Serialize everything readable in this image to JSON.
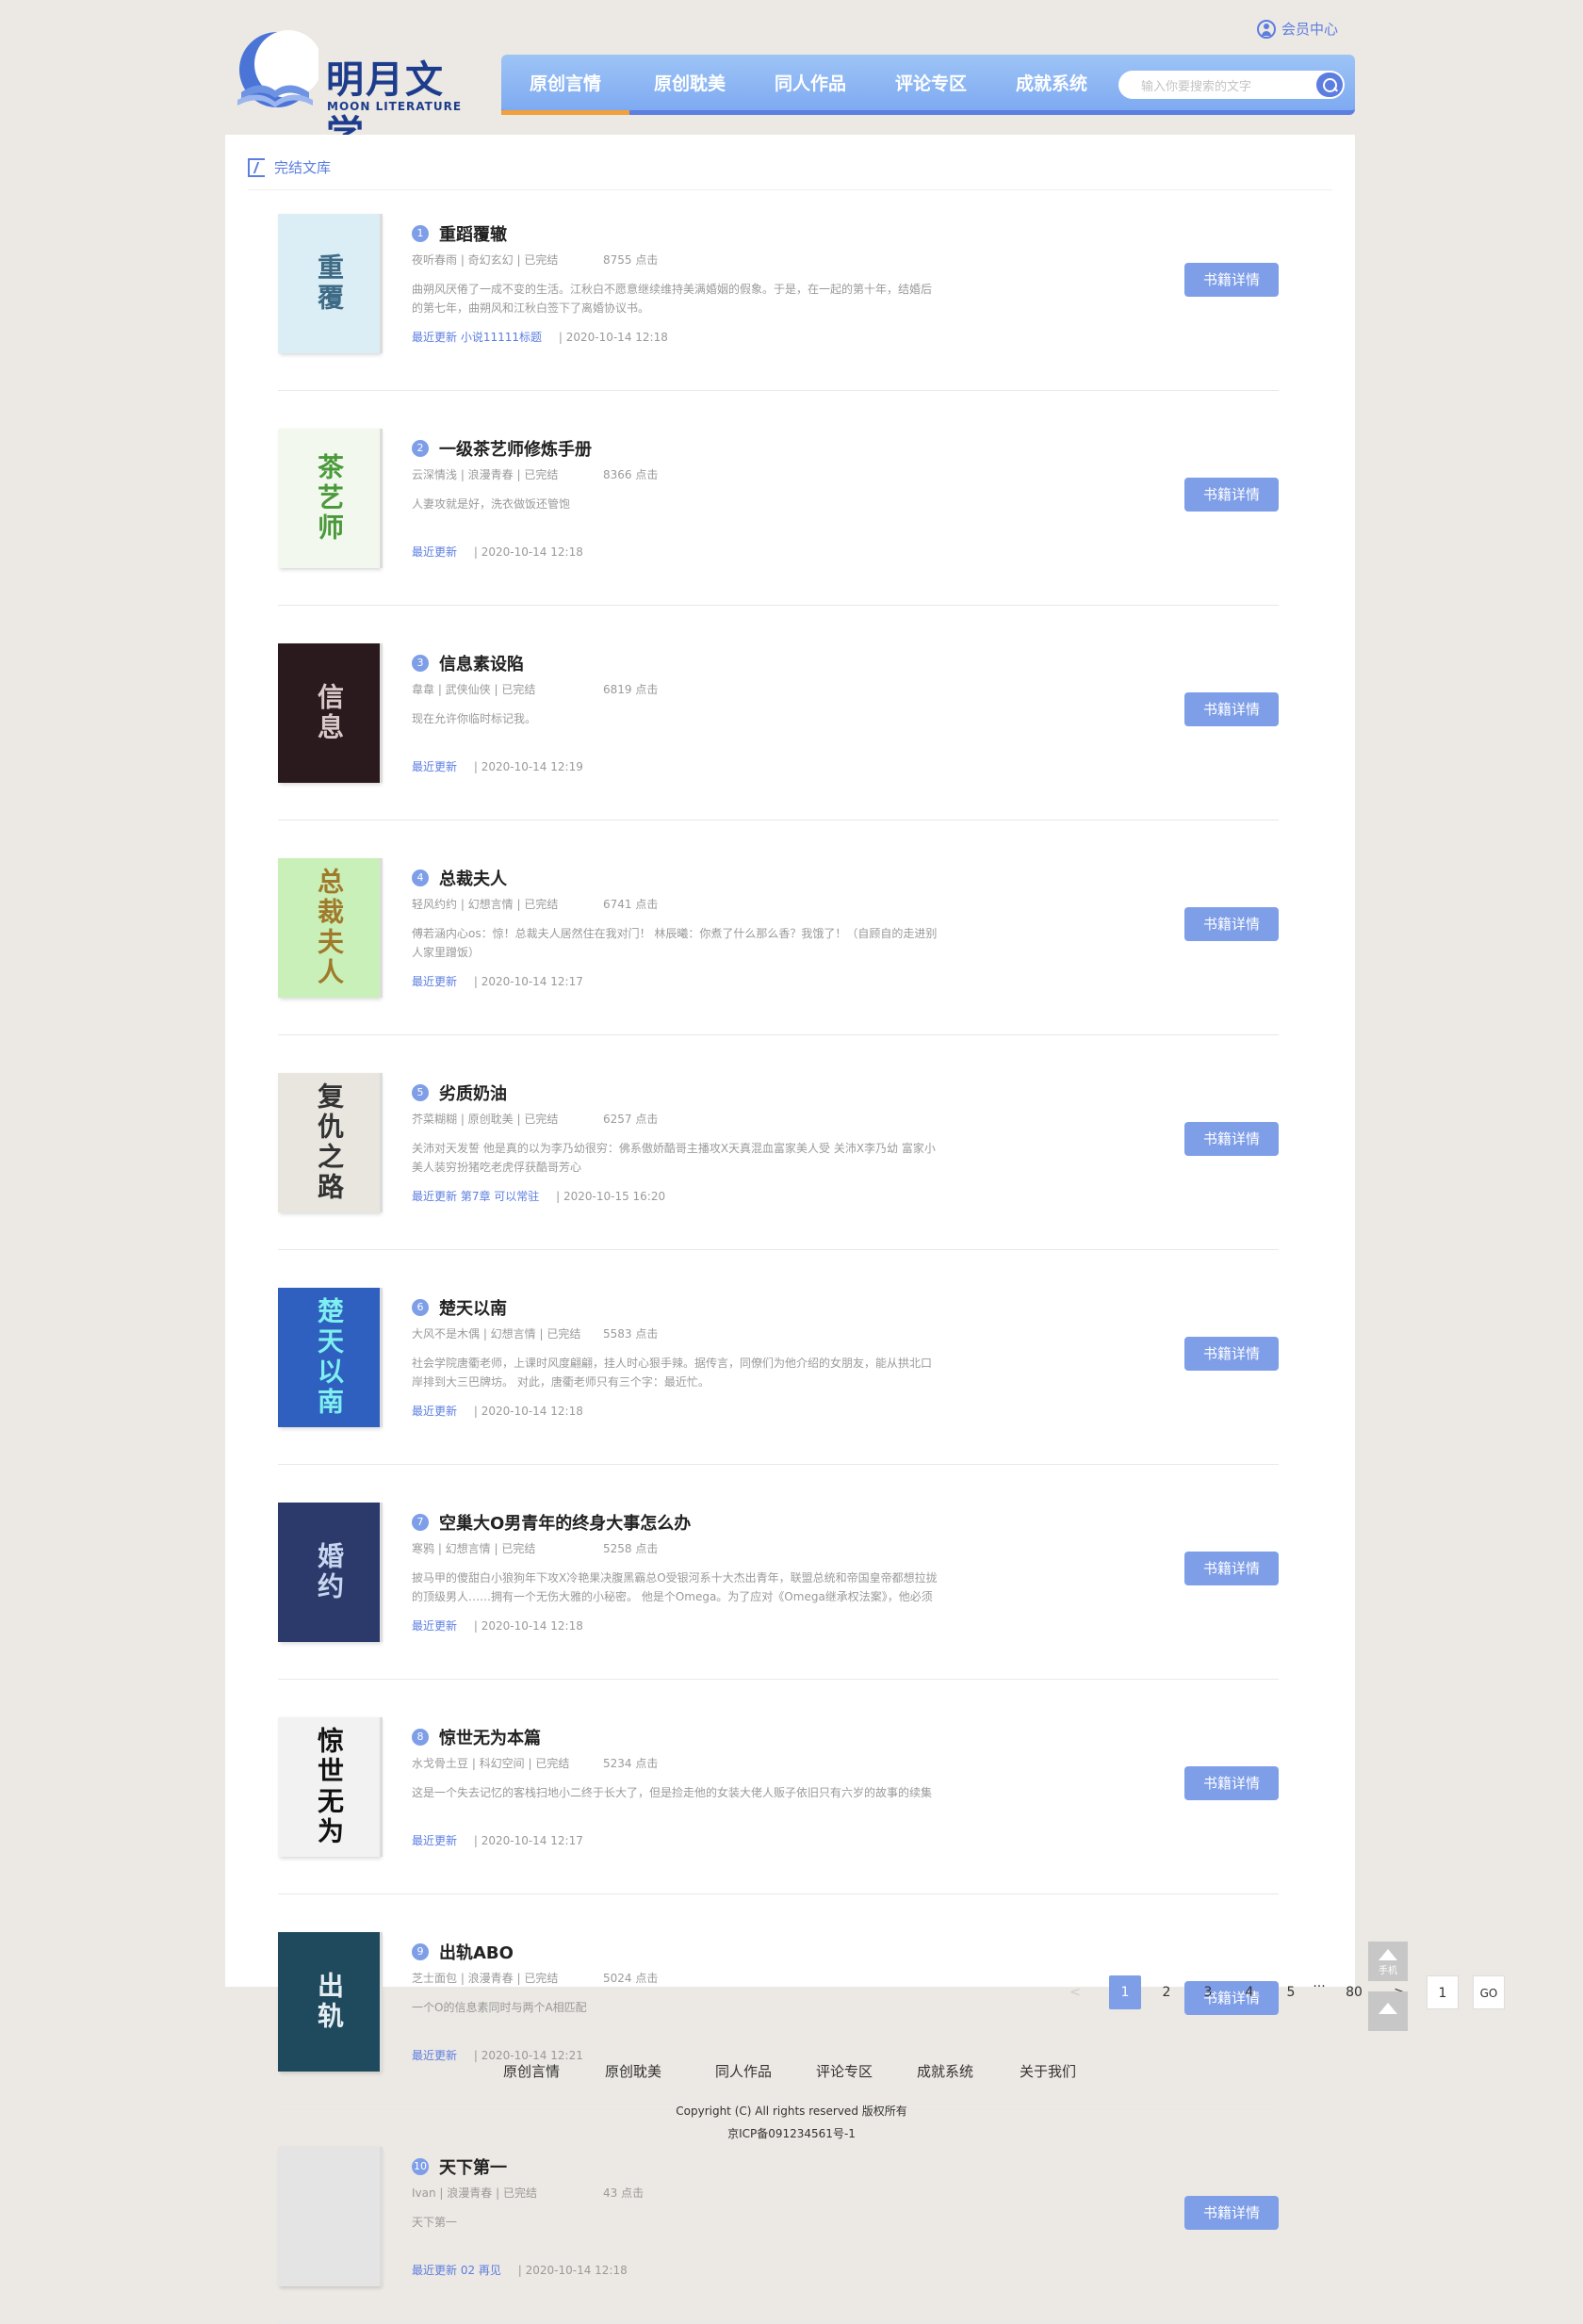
{
  "header": {
    "logo_cn": "明月文学",
    "logo_en": "MOON LITERATURE",
    "member_center": "会员中心",
    "nav": [
      "原创言情",
      "原创耽美",
      "同人作品",
      "评论专区",
      "成就系统"
    ],
    "search_placeholder": "输入你要搜索的文字"
  },
  "breadcrumb": "完结文库",
  "detail_label": "书籍详情",
  "books": [
    {
      "rank": "1",
      "title": "重蹈覆辙",
      "meta": "夜听春雨 | 奇幻玄幻 | 已完结",
      "clicks": "8755 点击",
      "desc": "曲朔风厌倦了一成不变的生活。江秋白不愿意继续维持美满婚姻的假象。于是，在一起的第十年，结婚后的第七年，曲朔风和江秋白签下了离婚协议书。",
      "update_label": "最近更新",
      "update_chapter": "小说11111标题",
      "update_time": "| 2020-10-14 12:18",
      "cover_text": "重覆",
      "cover_bg": "#dbeef6",
      "cover_fg": "#3e6a86"
    },
    {
      "rank": "2",
      "title": "一级茶艺师修炼手册",
      "meta": "云深情浅 | 浪漫青春 | 已完结",
      "clicks": "8366 点击",
      "desc": "人妻攻就是好，洗衣做饭还管饱",
      "update_label": "最近更新",
      "update_chapter": "",
      "update_time": "| 2020-10-14 12:18",
      "cover_text": "茶艺师",
      "cover_bg": "#f3f8ef",
      "cover_fg": "#4a9a3a"
    },
    {
      "rank": "3",
      "title": "信息素设陷",
      "meta": "韋韋 | 武侠仙侠 | 已完结",
      "clicks": "6819 点击",
      "desc": "现在允许你临时标记我。",
      "update_label": "最近更新",
      "update_chapter": "",
      "update_time": "| 2020-10-14 12:19",
      "cover_text": "信息",
      "cover_bg": "#2a1a1e",
      "cover_fg": "#d9c9c9"
    },
    {
      "rank": "4",
      "title": "总裁夫人",
      "meta": "轻风约约 | 幻想言情 | 已完结",
      "clicks": "6741 点击",
      "desc": "傅若涵内心os：惊！总裁夫人居然住在我对门！ 林辰曦：你煮了什么那么香？我饿了！（自顾自的走进别人家里蹭饭）",
      "update_label": "最近更新",
      "update_chapter": "",
      "update_time": "| 2020-10-14 12:17",
      "cover_text": "总裁夫人",
      "cover_bg": "#c9f0b8",
      "cover_fg": "#a07a2a"
    },
    {
      "rank": "5",
      "title": "劣质奶油",
      "meta": "芥菜糊糊 | 原创耽美 | 已完结",
      "clicks": "6257 点击",
      "desc": "关沛对天发誓 他是真的以为李乃幼很穷：佛系傲娇酷哥主播攻X天真混血富家美人受 关沛X李乃幼 富家小美人装穷扮猪吃老虎俘获酷哥芳心",
      "update_label": "最近更新",
      "update_chapter": "第7章 可以常驻",
      "update_time": "| 2020-10-15 16:20",
      "cover_text": "复仇之路",
      "cover_bg": "#e8e6df",
      "cover_fg": "#333333"
    },
    {
      "rank": "6",
      "title": "楚天以南",
      "meta": "大风不是木偶 | 幻想言情 | 已完结",
      "clicks": "5583 点击",
      "desc": "社会学院唐衢老师，上课时风度翩翩，挂人时心狠手辣。据传言，同僚们为他介绍的女朋友，能从拱北口岸排到大三巴牌坊。 对此，唐衢老师只有三个字：最近忙。",
      "update_label": "最近更新",
      "update_chapter": "",
      "update_time": "| 2020-10-14 12:18",
      "cover_text": "楚天以南",
      "cover_bg": "#2f5fbf",
      "cover_fg": "#7ef0f0"
    },
    {
      "rank": "7",
      "title": "空巢大O男青年的终身大事怎么办",
      "meta": "寒鸦 | 幻想言情 | 已完结",
      "clicks": "5258 点击",
      "desc": "披马甲的傻甜白小狼狗年下攻X冷艳果决腹黑霸总O受银河系十大杰出青年，联盟总统和帝国皇帝都想拉拢的顶级男人……拥有一个无伤大雅的小秘密。 他是个Omega。为了应对《Omega继承权法案》，他必须",
      "update_label": "最近更新",
      "update_chapter": "",
      "update_time": "| 2020-10-14 12:18",
      "cover_text": "婚约",
      "cover_bg": "#2b3a6a",
      "cover_fg": "#c9d6f0"
    },
    {
      "rank": "8",
      "title": "惊世无为本篇",
      "meta": "水戈骨土豆 | 科幻空间 | 已完结",
      "clicks": "5234 点击",
      "desc": "这是一个失去记忆的客栈扫地小二终于长大了，但是捡走他的女装大佬人贩子依旧只有六岁的故事的续集",
      "update_label": "最近更新",
      "update_chapter": "",
      "update_time": "| 2020-10-14 12:17",
      "cover_text": "惊世无为",
      "cover_bg": "#f2f2f2",
      "cover_fg": "#111111"
    },
    {
      "rank": "9",
      "title": "出轨ABO",
      "meta": "芝士面包 | 浪漫青春 | 已完结",
      "clicks": "5024 点击",
      "desc": "一个O的信息素同时与两个A相匹配",
      "update_label": "最近更新",
      "update_chapter": "",
      "update_time": "| 2020-10-14 12:21",
      "cover_text": "出轨",
      "cover_bg": "#1f4a5e",
      "cover_fg": "#e6eef2"
    },
    {
      "rank": "10",
      "title": "天下第一",
      "meta": "Ivan | 浪漫青春 | 已完结",
      "clicks": "43 点击",
      "desc": "天下第一",
      "update_label": "最近更新",
      "update_chapter": "02 再见",
      "update_time": "| 2020-10-14 12:18",
      "cover_text": "",
      "cover_bg": "#e4e4e4",
      "cover_fg": "#333333"
    }
  ],
  "pagination": {
    "prev": "<",
    "pages": [
      "1",
      "2",
      "3",
      "4",
      "5"
    ],
    "ellipsis": "···",
    "last": "80",
    "next": ">",
    "jump_value": "1",
    "go": "GO"
  },
  "side_tools": {
    "mobile": "手机",
    "top": "顶部"
  },
  "footer": {
    "links": [
      "原创言情",
      "原创耽美",
      "同人作品",
      "评论专区",
      "成就系统",
      "关于我们"
    ],
    "copyright": "Copyright (C) All rights reserved 版权所有",
    "icp": "京ICP备091234561号-1"
  }
}
